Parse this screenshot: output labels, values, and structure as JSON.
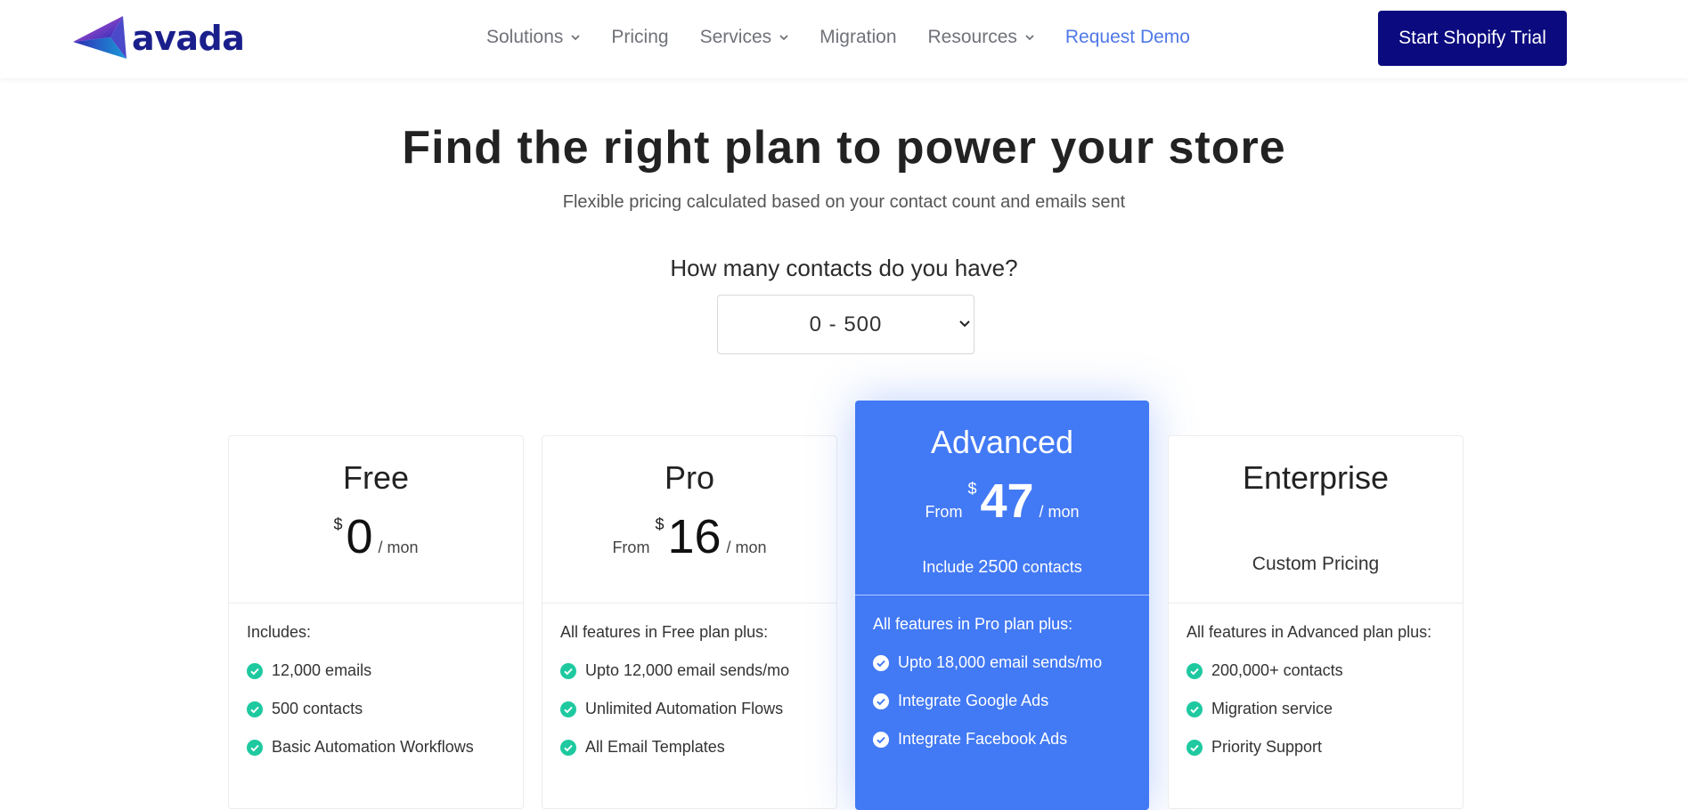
{
  "header": {
    "logo_text": "avada",
    "nav": [
      {
        "label": "Solutions",
        "dropdown": true
      },
      {
        "label": "Pricing",
        "dropdown": false
      },
      {
        "label": "Services",
        "dropdown": true
      },
      {
        "label": "Migration",
        "dropdown": false
      },
      {
        "label": "Resources",
        "dropdown": true
      },
      {
        "label": "Request Demo",
        "dropdown": false
      }
    ],
    "cta_label": "Start Shopify Trial"
  },
  "hero": {
    "title": "Find the right plan to power your store",
    "subtitle": "Flexible pricing calculated based on your contact count and emails sent",
    "contacts_question": "How many contacts do you have?",
    "contacts_selected": "0 - 500"
  },
  "plans": [
    {
      "name": "Free",
      "from": "",
      "currency": "$",
      "amount": "0",
      "period": "/ mon",
      "features_heading": "Includes:",
      "features": [
        "12,000 emails",
        "500 contacts",
        "Basic Automation Workflows"
      ]
    },
    {
      "name": "Pro",
      "from": "From",
      "currency": "$",
      "amount": "16",
      "period": "/ mon",
      "features_heading": "All features in Free plan plus:",
      "features": [
        "Upto 12,000 email sends/mo",
        "Unlimited Automation Flows",
        "All Email Templates"
      ]
    },
    {
      "name": "Advanced",
      "from": "From",
      "currency": "$",
      "amount": "47",
      "period": "/ mon",
      "include_prefix": "Include",
      "include_count": "2500",
      "include_suffix": "contacts",
      "features_heading": "All features in Pro plan plus:",
      "features": [
        "Upto 18,000 email sends/mo",
        "Integrate Google Ads",
        "Integrate Facebook Ads"
      ]
    },
    {
      "name": "Enterprise",
      "custom_pricing": "Custom Pricing",
      "features_heading": "All features in Advanced plan plus:",
      "features": [
        "200,000+ contacts",
        "Migration service",
        "Priority Support"
      ]
    }
  ],
  "colors": {
    "brand_navy": "#0b0a7e",
    "accent_blue": "#4279f4",
    "link_blue": "#4f78e8",
    "check_green": "#1ec9a0"
  }
}
